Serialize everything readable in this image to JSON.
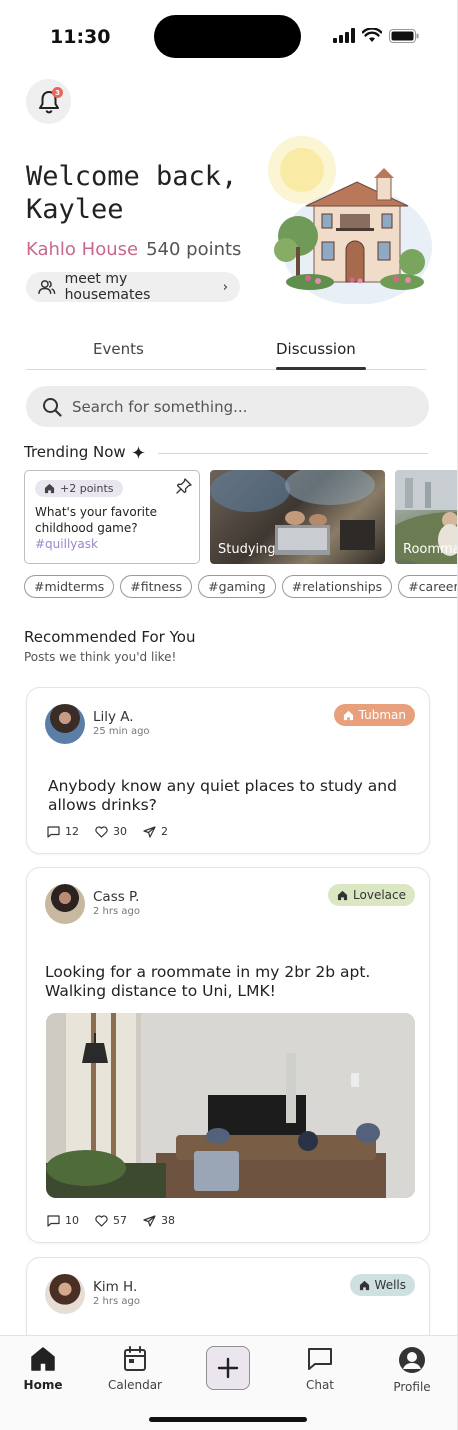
{
  "status_bar": {
    "time": "11:30"
  },
  "notifications": {
    "count": "3"
  },
  "welcome": {
    "line1": "Welcome back,",
    "line2": "Kaylee"
  },
  "house": {
    "name": "Kahlo House",
    "points": "540 points"
  },
  "housemates_button": {
    "label": "meet my housemates"
  },
  "tabs": [
    {
      "label": "Events"
    },
    {
      "label": "Discussion",
      "active": true
    }
  ],
  "search": {
    "placeholder": "Search for something..."
  },
  "trending": {
    "title": "Trending Now",
    "question_card": {
      "points": "+2 points",
      "text": "What's your favorite childhood game?",
      "tag": "#quillyask"
    },
    "image_cards": [
      {
        "label": "Studying"
      },
      {
        "label": "Roommates"
      }
    ],
    "tags": [
      "#midterms",
      "#fitness",
      "#gaming",
      "#relationships",
      "#careerhelp"
    ]
  },
  "recommended": {
    "title": "Recommended For You",
    "subtitle": "Posts we think you'd like!"
  },
  "posts": [
    {
      "author": "Lily A.",
      "time": "25 min ago",
      "house": "Tubman",
      "text": "Anybody know any quiet places to study and allows drinks?",
      "comments": "12",
      "likes": "30",
      "shares": "2"
    },
    {
      "author": "Cass P.",
      "time": "2 hrs ago",
      "house": "Lovelace",
      "text": "Looking for a roommate in my 2br 2b apt. Walking distance to Uni, LMK!",
      "comments": "10",
      "likes": "57",
      "shares": "38"
    },
    {
      "author": "Kim H.",
      "time": "2 hrs ago",
      "house": "Wells"
    }
  ],
  "nav": {
    "home": "Home",
    "calendar": "Calendar",
    "chat": "Chat",
    "profile": "Profile"
  },
  "colors": {
    "house_accent": "#c9678e",
    "tubman": "#e8a07c",
    "lovelace": "#dbe7c3",
    "wells": "#cfe0e0",
    "tag_purple": "#9b86c9",
    "badge_red": "#e6685d"
  }
}
